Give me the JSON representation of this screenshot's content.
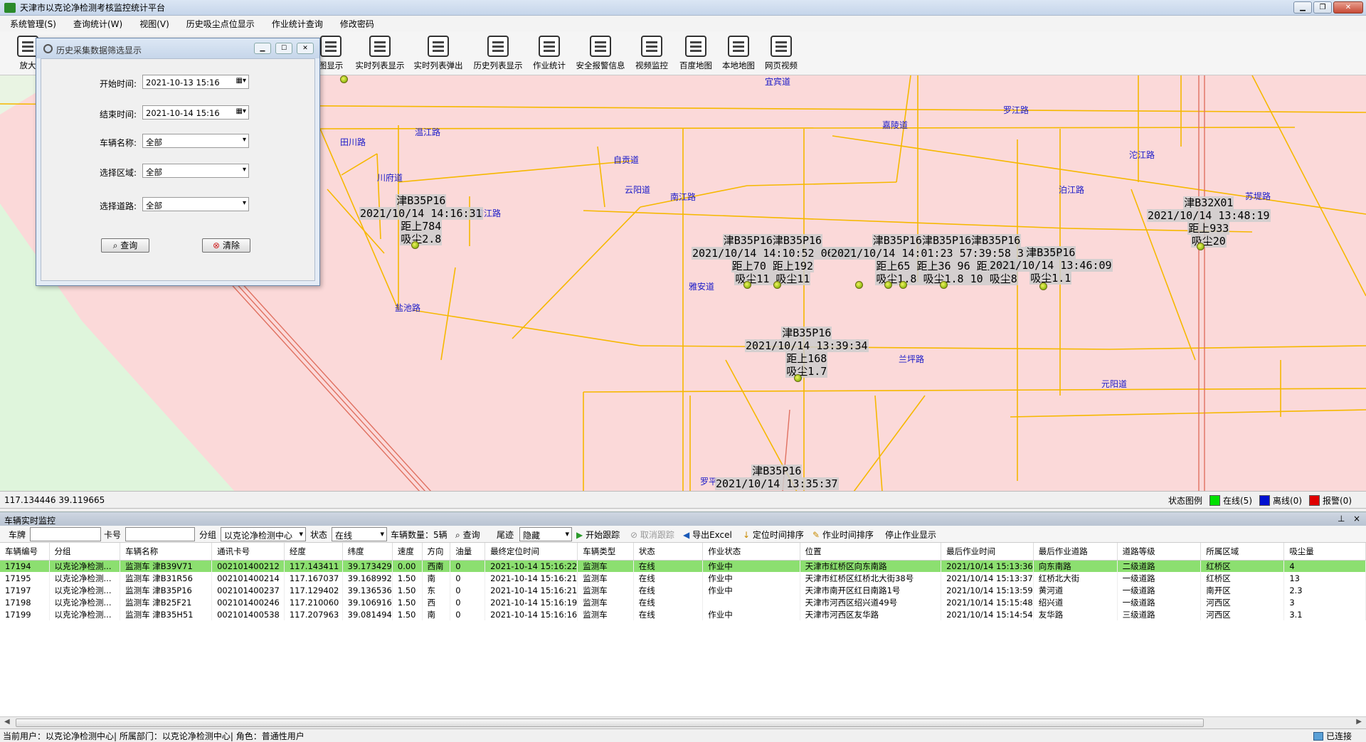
{
  "window": {
    "title": "天津市以克论净检测考核监控统计平台"
  },
  "menu": [
    "系统管理(S)",
    "查询统计(W)",
    "视图(V)",
    "历史吸尘点位显示",
    "作业统计查询",
    "修改密码"
  ],
  "toolbar": {
    "zoom": "放大",
    "partial": "图显示",
    "items": [
      "实时列表显示",
      "实时列表弹出",
      "历史列表显示",
      "作业统计",
      "安全报警信息",
      "视频监控",
      "百度地图",
      "本地地图",
      "网页视频"
    ]
  },
  "dialog": {
    "title": "历史采集数据筛选显示",
    "start_label": "开始时间:",
    "start_value": "2021-10-13 15:16",
    "end_label": "结束时间:",
    "end_value": "2021-10-14 15:16",
    "vehicle_label": "车辆名称:",
    "vehicle_value": "全部",
    "area_label": "选择区域:",
    "area_value": "全部",
    "road_label": "选择道路:",
    "road_value": "全部",
    "query_btn": "查询",
    "clear_btn": "清除"
  },
  "map": {
    "roads": [
      "宜宾道",
      "罗江路",
      "嘉陵道",
      "沱江路",
      "温江路",
      "田川路",
      "自贡道",
      "川府道",
      "云阳道",
      "泊江路",
      "苏堤路",
      "南江路",
      "前江路",
      "雅安道",
      "盐池路",
      "兰坪路",
      "元阳道",
      "罗平"
    ],
    "vehicles": [
      {
        "lines": [
          "津B35P16",
          "2021/10/14 14:16:31",
          "距上784",
          "吸尘2.8"
        ]
      },
      {
        "lines": [
          "津B35P16津B35P16",
          "2021/10/14 14:10:52 06:57",
          "距上70 距上192",
          "吸尘11 吸尘11"
        ]
      },
      {
        "lines": [
          "津B35P16津B35P16津B35P16",
          "2021/10/14 14:01:23 57:39:58 3:50:09",
          "距上65 距上36 96 距上231",
          "吸尘1.8 吸尘1.8 10 吸尘8"
        ]
      },
      {
        "lines": [
          "津B35P16",
          "2021/10/14 13:46:09",
          "吸尘1.1"
        ]
      },
      {
        "lines": [
          "津B32X01",
          "2021/10/14 13:48:19",
          "距上933",
          "吸尘20"
        ]
      },
      {
        "lines": [
          "津B35P16",
          "2021/10/14 13:39:34",
          "距上168",
          "吸尘1.7"
        ]
      },
      {
        "lines": [
          "津B35P16",
          "2021/10/14 13:35:37"
        ]
      }
    ]
  },
  "coords": "117.134446  39.119665",
  "legend": {
    "label": "状态图例",
    "online": "在线(5)",
    "offline": "离线(0)",
    "alarm": "报警(0)",
    "online_color": "#00e000",
    "offline_color": "#0010d0",
    "alarm_color": "#e00000"
  },
  "panel": {
    "title": "车辆实时监控",
    "pin": "⊥",
    "close": "×",
    "plate_label": "车牌",
    "card_label": "卡号",
    "group_label": "分组",
    "group_value": "以克论净检测中心",
    "status_label": "状态",
    "status_value": "在线",
    "count_label": "车辆数量：5辆",
    "query": "查询",
    "trail_label": "尾迹",
    "trail_value": "隐藏",
    "start_track": "开始跟踪",
    "cancel_track": "取消跟踪",
    "export": "导出Excel",
    "sort_loc": "定位时间排序",
    "sort_work": "作业时间排序",
    "stop_work": "停止作业显示"
  },
  "table": {
    "headers": [
      "车辆编号",
      "分组",
      "车辆名称",
      "通讯卡号",
      "经度",
      "纬度",
      "速度",
      "方向",
      "油量",
      "最终定位时间",
      "车辆类型",
      "状态",
      "作业状态",
      "位置",
      "最后作业时间",
      "最后作业道路",
      "道路等级",
      "所属区域",
      "吸尘量"
    ],
    "rows": [
      [
        "17194",
        "以克论净检测...",
        "监测车 津B39V71",
        "002101400212",
        "117.143411",
        "39.173429",
        "0.00",
        "西南",
        "0",
        "2021-10-14 15:16:22",
        "监测车",
        "在线",
        "作业中",
        "天津市红桥区向东南路",
        "2021/10/14 15:13:36",
        "向东南路",
        "二级道路",
        "红桥区",
        "4"
      ],
      [
        "17195",
        "以克论净检测...",
        "监测车 津B31R56",
        "002101400214",
        "117.167037",
        "39.168992",
        "1.50",
        "南",
        "0",
        "2021-10-14 15:16:21",
        "监测车",
        "在线",
        "作业中",
        "天津市红桥区红桥北大街38号",
        "2021/10/14 15:13:37",
        "红桥北大街",
        "一级道路",
        "红桥区",
        "13"
      ],
      [
        "17197",
        "以克论净检测...",
        "监测车 津B35P16",
        "002101400237",
        "117.129402",
        "39.136536",
        "1.50",
        "东",
        "0",
        "2021-10-14 15:16:21",
        "监测车",
        "在线",
        "作业中",
        "天津市南开区红日南路1号",
        "2021/10/14 15:13:59",
        "黄河道",
        "一级道路",
        "南开区",
        "2.3"
      ],
      [
        "17198",
        "以克论净检测...",
        "监测车 津B25F21",
        "002101400246",
        "117.210060",
        "39.106916",
        "1.50",
        "西",
        "0",
        "2021-10-14 15:16:19",
        "监测车",
        "在线",
        "",
        "天津市河西区绍兴道49号",
        "2021/10/14 15:15:48",
        "绍兴道",
        "一级道路",
        "河西区",
        "3"
      ],
      [
        "17199",
        "以克论净检测...",
        "监测车 津B35H51",
        "002101400538",
        "117.207963",
        "39.081494",
        "1.50",
        "南",
        "0",
        "2021-10-14 15:16:16",
        "监测车",
        "在线",
        "作业中",
        "天津市河西区友华路",
        "2021/10/14 15:14:54",
        "友华路",
        "三级道路",
        "河西区",
        "3.1"
      ]
    ]
  },
  "statusbar": {
    "text": "当前用户：以克论净检测中心| 所属部门：以克论净检测中心| 角色：普通性用户",
    "connection": "已连接"
  }
}
